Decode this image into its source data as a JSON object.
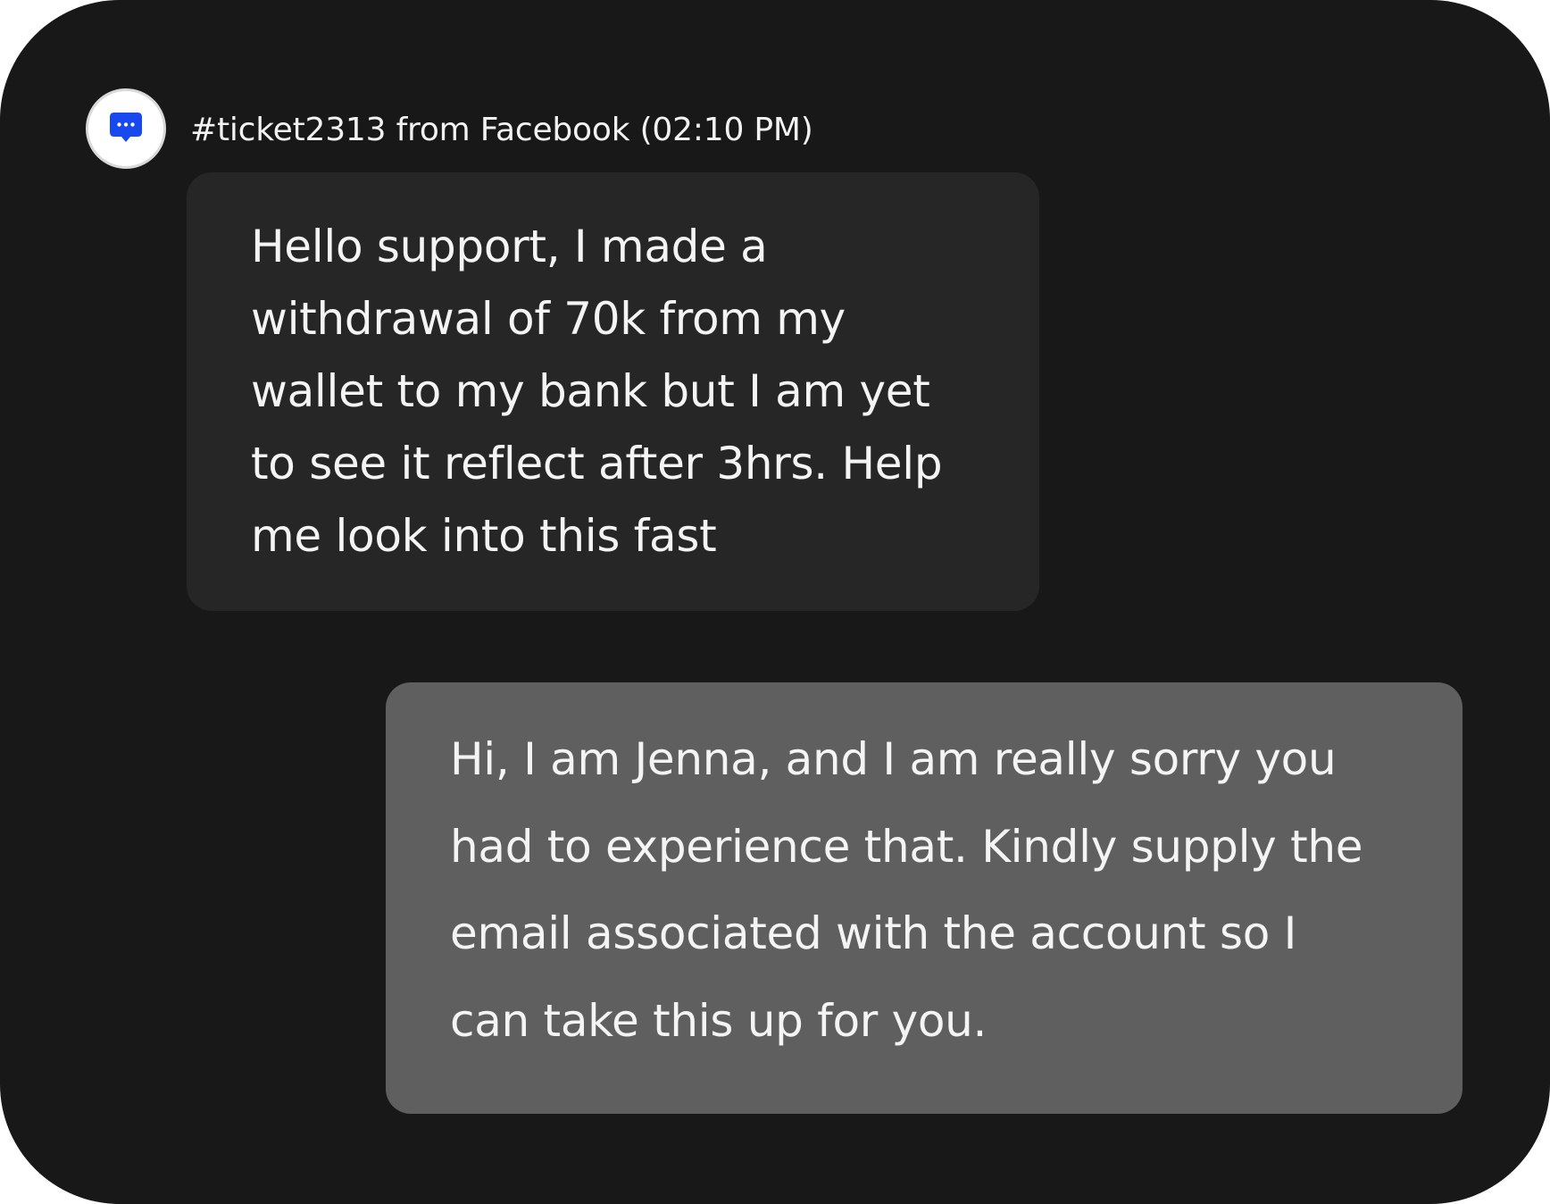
{
  "ticket": {
    "header": "#ticket2313 from Facebook (02:10 PM)",
    "channel_icon": "chat-bubble-icon",
    "icon_color": "#1748F0"
  },
  "messages": {
    "incoming": {
      "lines": [
        "Hello support, I made a",
        "withdrawal of 70k from my",
        "wallet to my bank but I am yet",
        "to see it reflect after 3hrs. Help",
        "me look into this fast"
      ]
    },
    "outgoing": {
      "lines": [
        "Hi, I am Jenna, and I am really sorry you",
        "had to experience that. Kindly supply the",
        "email associated with the account so I",
        "can take this up for you."
      ]
    }
  }
}
